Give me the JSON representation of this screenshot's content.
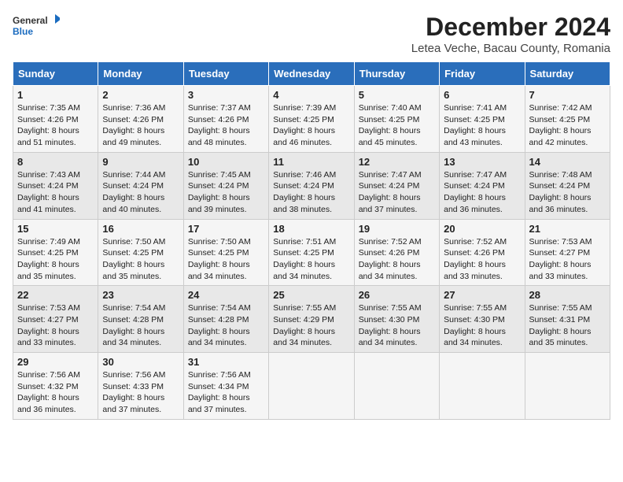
{
  "logo": {
    "line1": "General",
    "line2": "Blue"
  },
  "title": "December 2024",
  "subtitle": "Letea Veche, Bacau County, Romania",
  "days_of_week": [
    "Sunday",
    "Monday",
    "Tuesday",
    "Wednesday",
    "Thursday",
    "Friday",
    "Saturday"
  ],
  "weeks": [
    [
      {
        "day": "1",
        "detail": "Sunrise: 7:35 AM\nSunset: 4:26 PM\nDaylight: 8 hours and 51 minutes."
      },
      {
        "day": "2",
        "detail": "Sunrise: 7:36 AM\nSunset: 4:26 PM\nDaylight: 8 hours and 49 minutes."
      },
      {
        "day": "3",
        "detail": "Sunrise: 7:37 AM\nSunset: 4:26 PM\nDaylight: 8 hours and 48 minutes."
      },
      {
        "day": "4",
        "detail": "Sunrise: 7:39 AM\nSunset: 4:25 PM\nDaylight: 8 hours and 46 minutes."
      },
      {
        "day": "5",
        "detail": "Sunrise: 7:40 AM\nSunset: 4:25 PM\nDaylight: 8 hours and 45 minutes."
      },
      {
        "day": "6",
        "detail": "Sunrise: 7:41 AM\nSunset: 4:25 PM\nDaylight: 8 hours and 43 minutes."
      },
      {
        "day": "7",
        "detail": "Sunrise: 7:42 AM\nSunset: 4:25 PM\nDaylight: 8 hours and 42 minutes."
      }
    ],
    [
      {
        "day": "8",
        "detail": "Sunrise: 7:43 AM\nSunset: 4:24 PM\nDaylight: 8 hours and 41 minutes."
      },
      {
        "day": "9",
        "detail": "Sunrise: 7:44 AM\nSunset: 4:24 PM\nDaylight: 8 hours and 40 minutes."
      },
      {
        "day": "10",
        "detail": "Sunrise: 7:45 AM\nSunset: 4:24 PM\nDaylight: 8 hours and 39 minutes."
      },
      {
        "day": "11",
        "detail": "Sunrise: 7:46 AM\nSunset: 4:24 PM\nDaylight: 8 hours and 38 minutes."
      },
      {
        "day": "12",
        "detail": "Sunrise: 7:47 AM\nSunset: 4:24 PM\nDaylight: 8 hours and 37 minutes."
      },
      {
        "day": "13",
        "detail": "Sunrise: 7:47 AM\nSunset: 4:24 PM\nDaylight: 8 hours and 36 minutes."
      },
      {
        "day": "14",
        "detail": "Sunrise: 7:48 AM\nSunset: 4:24 PM\nDaylight: 8 hours and 36 minutes."
      }
    ],
    [
      {
        "day": "15",
        "detail": "Sunrise: 7:49 AM\nSunset: 4:25 PM\nDaylight: 8 hours and 35 minutes."
      },
      {
        "day": "16",
        "detail": "Sunrise: 7:50 AM\nSunset: 4:25 PM\nDaylight: 8 hours and 35 minutes."
      },
      {
        "day": "17",
        "detail": "Sunrise: 7:50 AM\nSunset: 4:25 PM\nDaylight: 8 hours and 34 minutes."
      },
      {
        "day": "18",
        "detail": "Sunrise: 7:51 AM\nSunset: 4:25 PM\nDaylight: 8 hours and 34 minutes."
      },
      {
        "day": "19",
        "detail": "Sunrise: 7:52 AM\nSunset: 4:26 PM\nDaylight: 8 hours and 34 minutes."
      },
      {
        "day": "20",
        "detail": "Sunrise: 7:52 AM\nSunset: 4:26 PM\nDaylight: 8 hours and 33 minutes."
      },
      {
        "day": "21",
        "detail": "Sunrise: 7:53 AM\nSunset: 4:27 PM\nDaylight: 8 hours and 33 minutes."
      }
    ],
    [
      {
        "day": "22",
        "detail": "Sunrise: 7:53 AM\nSunset: 4:27 PM\nDaylight: 8 hours and 33 minutes."
      },
      {
        "day": "23",
        "detail": "Sunrise: 7:54 AM\nSunset: 4:28 PM\nDaylight: 8 hours and 34 minutes."
      },
      {
        "day": "24",
        "detail": "Sunrise: 7:54 AM\nSunset: 4:28 PM\nDaylight: 8 hours and 34 minutes."
      },
      {
        "day": "25",
        "detail": "Sunrise: 7:55 AM\nSunset: 4:29 PM\nDaylight: 8 hours and 34 minutes."
      },
      {
        "day": "26",
        "detail": "Sunrise: 7:55 AM\nSunset: 4:30 PM\nDaylight: 8 hours and 34 minutes."
      },
      {
        "day": "27",
        "detail": "Sunrise: 7:55 AM\nSunset: 4:30 PM\nDaylight: 8 hours and 34 minutes."
      },
      {
        "day": "28",
        "detail": "Sunrise: 7:55 AM\nSunset: 4:31 PM\nDaylight: 8 hours and 35 minutes."
      }
    ],
    [
      {
        "day": "29",
        "detail": "Sunrise: 7:56 AM\nSunset: 4:32 PM\nDaylight: 8 hours and 36 minutes."
      },
      {
        "day": "30",
        "detail": "Sunrise: 7:56 AM\nSunset: 4:33 PM\nDaylight: 8 hours and 37 minutes."
      },
      {
        "day": "31",
        "detail": "Sunrise: 7:56 AM\nSunset: 4:34 PM\nDaylight: 8 hours and 37 minutes."
      },
      null,
      null,
      null,
      null
    ]
  ]
}
